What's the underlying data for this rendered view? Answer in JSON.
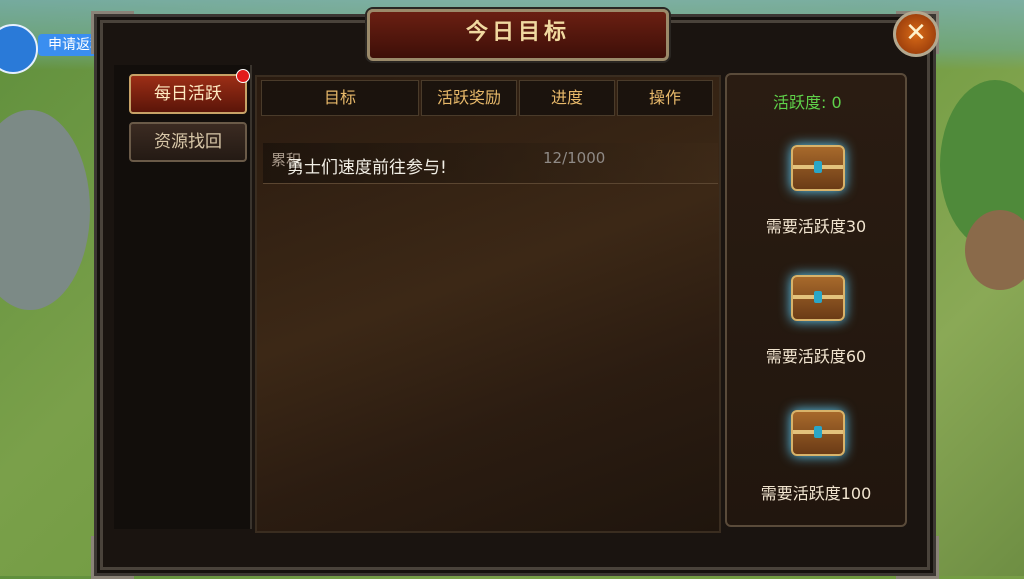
{
  "overlay": {
    "apply_rebate_label": "申请返利"
  },
  "panel": {
    "title": "今日目标",
    "close_symbol": "✕"
  },
  "tabs": [
    {
      "label": "每日活跃",
      "active": true,
      "has_notification": true
    },
    {
      "label": "资源找回",
      "active": false
    }
  ],
  "table": {
    "headers": [
      "目标",
      "活跃奖励",
      "进度",
      "操作"
    ],
    "rows": [
      {
        "goal": "累积",
        "progress": "12/1000"
      }
    ],
    "overlay_text": "勇士们速度前往参与!"
  },
  "rewards": {
    "activity_label": "活跃度: 0",
    "chests": [
      {
        "requirement": "需要活跃度30",
        "icon": "treasure-chest-icon"
      },
      {
        "requirement": "需要活跃度60",
        "icon": "treasure-chest-icon"
      },
      {
        "requirement": "需要活跃度100",
        "icon": "treasure-chest-icon"
      }
    ]
  },
  "colors": {
    "accent_green": "#5fd24a",
    "header_gold": "#e8b96a",
    "title_red": "#6a1f12"
  }
}
